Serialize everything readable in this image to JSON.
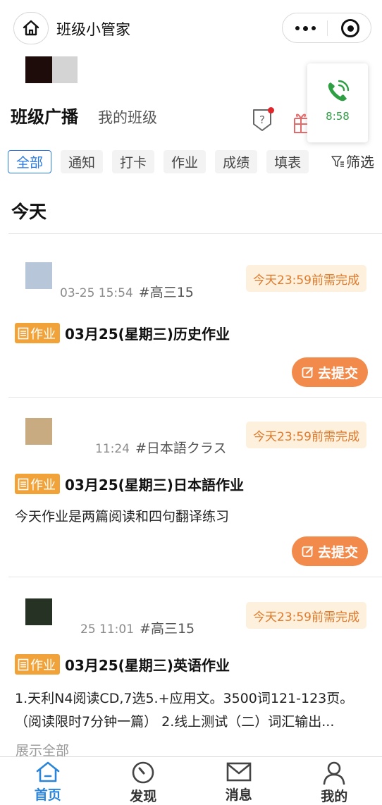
{
  "app": {
    "title": "班级小管家"
  },
  "call": {
    "time": "8:58"
  },
  "sections": {
    "broadcast": "班级广播",
    "my_class": "我的班级"
  },
  "filters": {
    "chips": [
      "全部",
      "通知",
      "打卡",
      "作业",
      "成绩",
      "填表"
    ],
    "active_index": 0,
    "filter_label": "筛选"
  },
  "today_heading": "今天",
  "posts": [
    {
      "date": "03-25 15:54",
      "class": "#高三15",
      "deadline": "今天23:59前需完成",
      "badge": "作业",
      "title": "03月25(星期三)历史作业",
      "submit": "去提交",
      "avatar_color": "#b7c6d8"
    },
    {
      "date": "11:24",
      "class": "#日本語クラス",
      "deadline": "今天23:59前需完成",
      "badge": "作业",
      "title": "03月25(星期三)日本語作业",
      "body": [
        "今天作业是两篇阅读和四句翻译练习"
      ],
      "submit": "去提交",
      "avatar_color": "#c9ab82"
    },
    {
      "date": "25 11:01",
      "class": "#高三15",
      "deadline": "今天23:59前需完成",
      "badge": "作业",
      "title": "03月25(星期三)英语作业",
      "body": [
        "1.天利N4阅读CD,7选5.+应用文。3500词121-123页。",
        "（阅读限时7分钟一篇） 2.线上测试（二）词汇输出..."
      ],
      "show_all": "展示全部",
      "avatar_color": "#263224"
    }
  ],
  "nav": [
    {
      "label": "首页",
      "icon": "home-icon",
      "active": true
    },
    {
      "label": "发现",
      "icon": "compass-icon",
      "active": false
    },
    {
      "label": "消息",
      "icon": "mail-icon",
      "active": false
    },
    {
      "label": "我的",
      "icon": "person-icon",
      "active": false
    }
  ],
  "colors": {
    "accent_blue": "#2a85d9",
    "badge_orange": "#f1a33a",
    "submit_orange": "#f28a4b",
    "deadline_text": "#e07a2c",
    "deadline_bg": "#fdf0dc",
    "call_green": "#2ea043"
  }
}
